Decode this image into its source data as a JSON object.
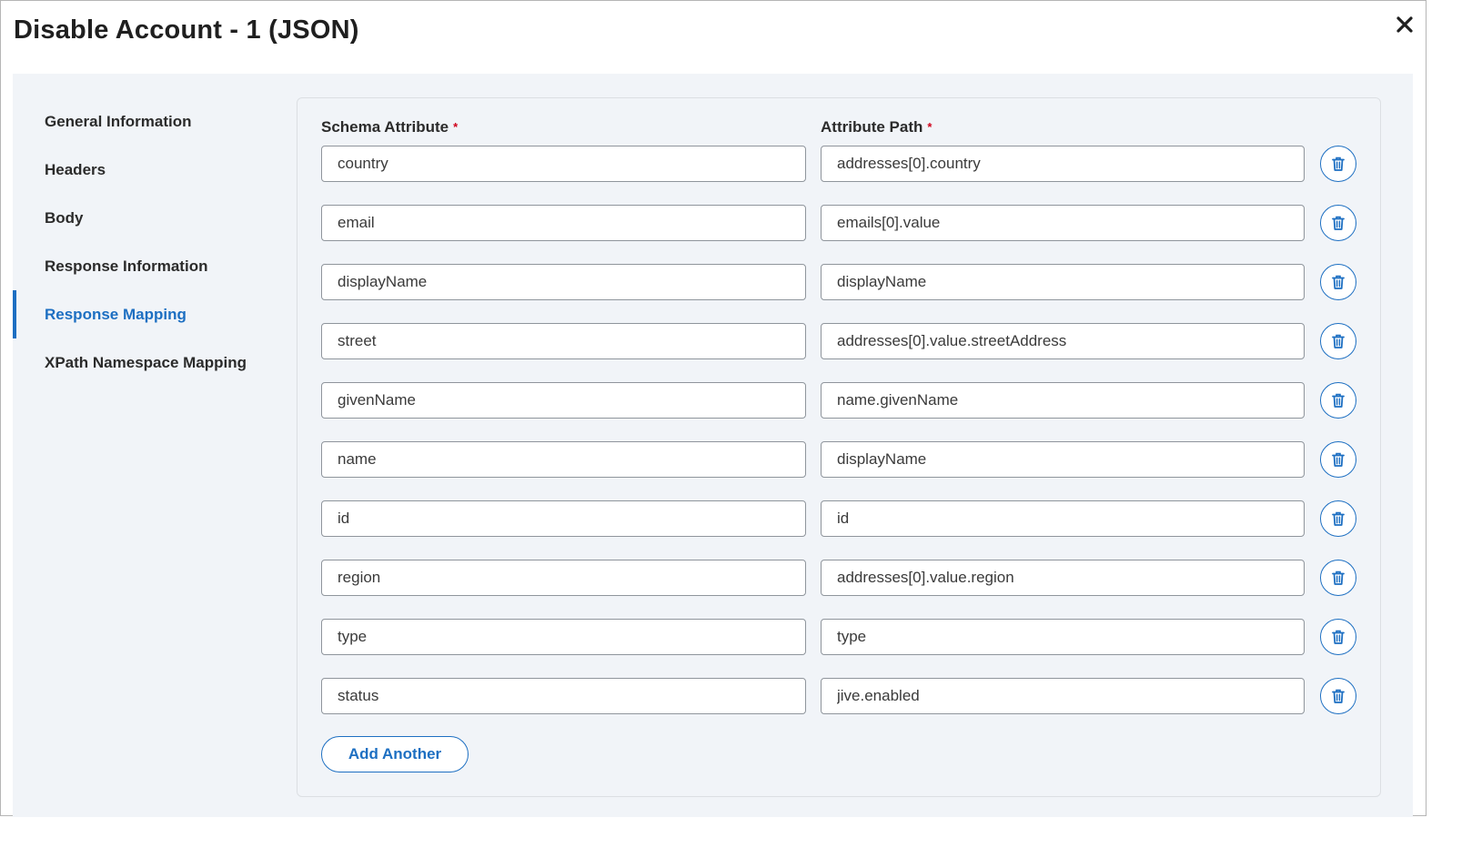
{
  "dialog": {
    "title": "Disable Account - 1 (JSON)",
    "close_icon": "close-icon"
  },
  "sidebar": {
    "items": [
      {
        "label": "General Information",
        "active": false
      },
      {
        "label": "Headers",
        "active": false
      },
      {
        "label": "Body",
        "active": false
      },
      {
        "label": "Response Information",
        "active": false
      },
      {
        "label": "Response Mapping",
        "active": true
      },
      {
        "label": "XPath Namespace Mapping",
        "active": false
      }
    ]
  },
  "mapping": {
    "schema_attribute_label": "Schema Attribute",
    "attribute_path_label": "Attribute Path",
    "required_marker": "*",
    "rows": [
      {
        "schema_attribute": "country",
        "attribute_path": "addresses[0].country"
      },
      {
        "schema_attribute": "email",
        "attribute_path": "emails[0].value"
      },
      {
        "schema_attribute": "displayName",
        "attribute_path": "displayName"
      },
      {
        "schema_attribute": "street",
        "attribute_path": "addresses[0].value.streetAddress"
      },
      {
        "schema_attribute": "givenName",
        "attribute_path": "name.givenName"
      },
      {
        "schema_attribute": "name",
        "attribute_path": "displayName"
      },
      {
        "schema_attribute": "id",
        "attribute_path": "id"
      },
      {
        "schema_attribute": "region",
        "attribute_path": "addresses[0].value.region"
      },
      {
        "schema_attribute": "type",
        "attribute_path": "type"
      },
      {
        "schema_attribute": "status",
        "attribute_path": "jive.enabled"
      }
    ],
    "delete_icon": "trash-icon",
    "add_button_label": "Add Another"
  },
  "colors": {
    "accent": "#1d6fc2",
    "required": "#d0021b",
    "panel_background": "#f1f4f8"
  }
}
